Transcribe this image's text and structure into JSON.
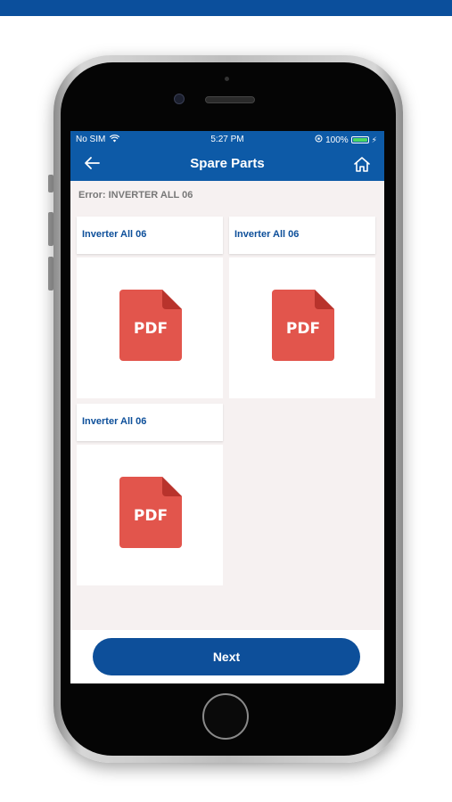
{
  "status_bar": {
    "carrier": "No SIM",
    "time": "5:27 PM",
    "battery": "100%",
    "battery_level": 1.0
  },
  "nav": {
    "back_icon": "arrow-left-icon",
    "title": "Spare Parts",
    "home_icon": "home-icon"
  },
  "error_label": "Error: INVERTER ALL 06",
  "documents": [
    {
      "title": "Inverter All 06",
      "icon_label": "PDF"
    },
    {
      "title": "Inverter All 06",
      "icon_label": "PDF"
    },
    {
      "title": "Inverter All 06",
      "icon_label": "PDF"
    }
  ],
  "next_button": {
    "label": "Next"
  },
  "colors": {
    "brand": "#0d5aa7",
    "button": "#0d4f9a",
    "pdf": "#e2554c",
    "pdf_fold": "#b8332c"
  }
}
